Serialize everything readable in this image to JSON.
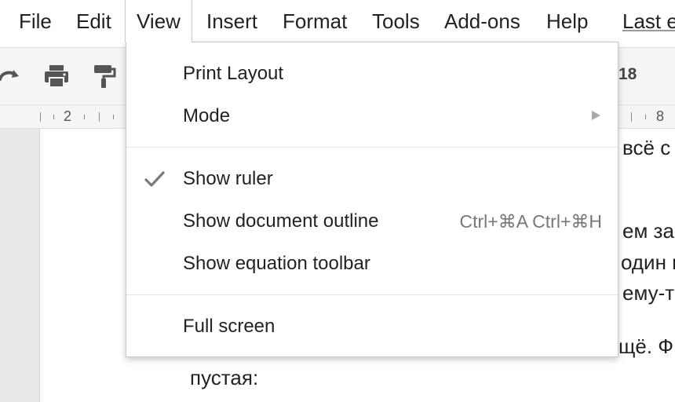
{
  "menubar": {
    "file": "File",
    "edit": "Edit",
    "view": "View",
    "insert": "Insert",
    "format": "Format",
    "tools": "Tools",
    "addons": "Add-ons",
    "help": "Help",
    "last_edit": "Last e"
  },
  "toolbar": {
    "font_size": "18",
    "icons": [
      "redo-icon",
      "print-icon",
      "paint-format-icon"
    ]
  },
  "ruler": {
    "left_number": "2",
    "right_number": "8"
  },
  "view_menu": {
    "print_layout": "Print Layout",
    "mode": "Mode",
    "show_ruler": "Show ruler",
    "show_ruler_checked": true,
    "show_document_outline": "Show document outline",
    "show_document_outline_shortcut": "Ctrl+⌘A Ctrl+⌘H",
    "show_equation_toolbar": "Show equation toolbar",
    "full_screen": "Full screen"
  },
  "document": {
    "lines": [
      "всё с",
      "ем за",
      "один п",
      "ему-т",
      "щё. Ф",
      "пустая:"
    ]
  },
  "colors": {
    "text": "#222222",
    "muted": "#777777",
    "toolbar_bg": "#f5f5f5",
    "menu_border": "#c9c9c9"
  }
}
